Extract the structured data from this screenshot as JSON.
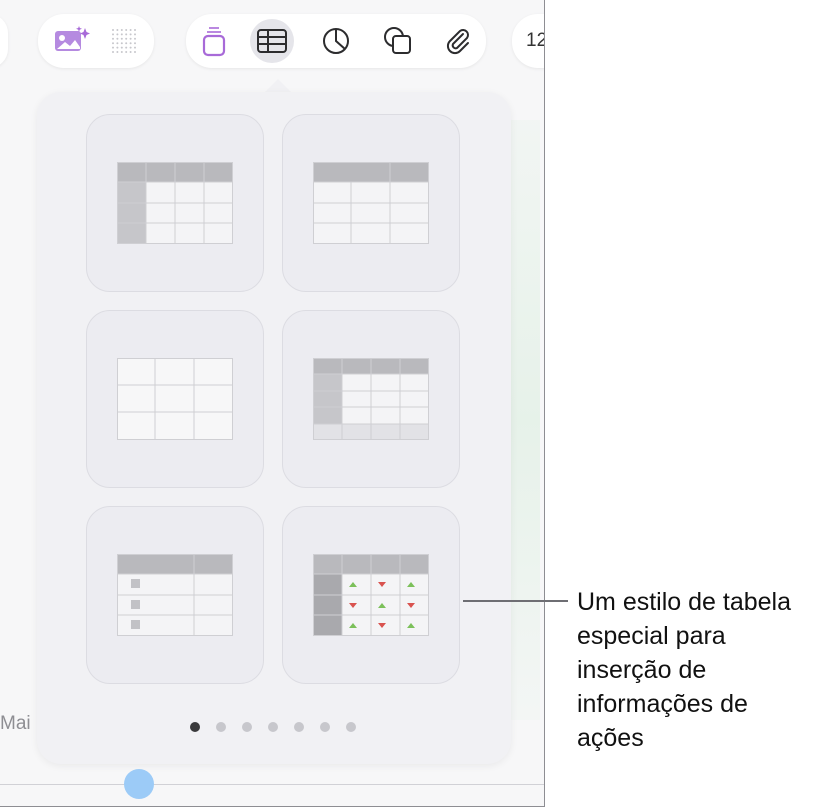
{
  "toolbar": {
    "right_label": "12",
    "buttons": [
      {
        "name": "media-button",
        "icon": "photo-sparkle-icon"
      },
      {
        "name": "grid-button",
        "icon": "dotted-grid-icon"
      },
      {
        "name": "text-box-button",
        "icon": "text-box-icon"
      },
      {
        "name": "table-button",
        "icon": "table-icon",
        "selected": true
      },
      {
        "name": "chart-button",
        "icon": "pie-chart-icon"
      },
      {
        "name": "shape-button",
        "icon": "shapes-icon"
      },
      {
        "name": "attachment-button",
        "icon": "paperclip-icon"
      }
    ]
  },
  "table_styles": [
    {
      "name": "table-style-header-row-column"
    },
    {
      "name": "table-style-header-row"
    },
    {
      "name": "table-style-plain"
    },
    {
      "name": "table-style-header-footer"
    },
    {
      "name": "table-style-checklist"
    },
    {
      "name": "table-style-stocks"
    }
  ],
  "pagination": {
    "total": 7,
    "current": 1
  },
  "axis": {
    "month_label": "Mai"
  },
  "callout": {
    "text": "Um estilo de tabela especial para inserção de informações de ações"
  },
  "colors": {
    "accent": "#a86ad8",
    "selected_bg": "#e5e5ea",
    "up": "#7cc05a",
    "down": "#d9534f"
  }
}
